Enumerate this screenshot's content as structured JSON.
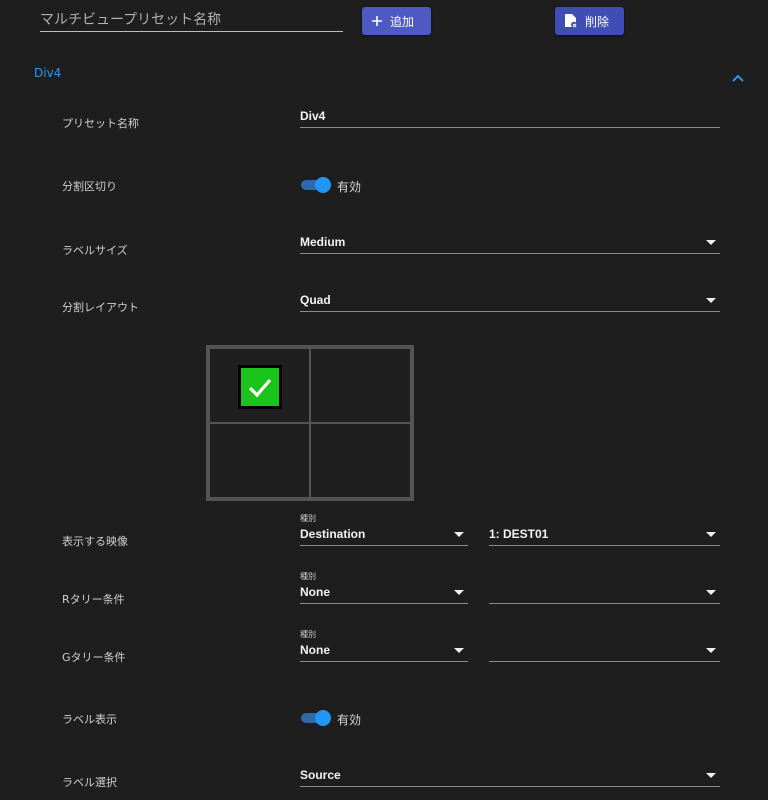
{
  "toolbar": {
    "preset_name_placeholder": "マルチビュープリセット名称",
    "add_label": "追加",
    "delete_label": "削除"
  },
  "panel": {
    "title": "Div4",
    "expanded": true,
    "fields": {
      "preset_name": {
        "label": "プリセット名称",
        "value": "Div4"
      },
      "divider": {
        "label": "分割区切り",
        "enabled": true,
        "state_text": "有効"
      },
      "label_size": {
        "label": "ラベルサイズ",
        "value": "Medium"
      },
      "layout": {
        "label": "分割レイアウト",
        "value": "Quad"
      },
      "layout_grid": {
        "rows": 2,
        "cols": 2,
        "selected_cell": 0
      },
      "video": {
        "label": "表示する映像",
        "type_caption": "種別",
        "type_value": "Destination",
        "target_value": "1: DEST01"
      },
      "r_tally": {
        "label": "Rタリー条件",
        "type_caption": "種別",
        "type_value": "None",
        "target_value": ""
      },
      "g_tally": {
        "label": "Gタリー条件",
        "type_caption": "種別",
        "type_value": "None",
        "target_value": ""
      },
      "label_display": {
        "label": "ラベル表示",
        "enabled": true,
        "state_text": "有効"
      },
      "label_select": {
        "label": "ラベル選択",
        "value": "Source"
      }
    }
  },
  "colors": {
    "accent": "#2196f3",
    "button": "#4a56c0",
    "check": "#1ac41a",
    "background": "#1e1e1e"
  }
}
